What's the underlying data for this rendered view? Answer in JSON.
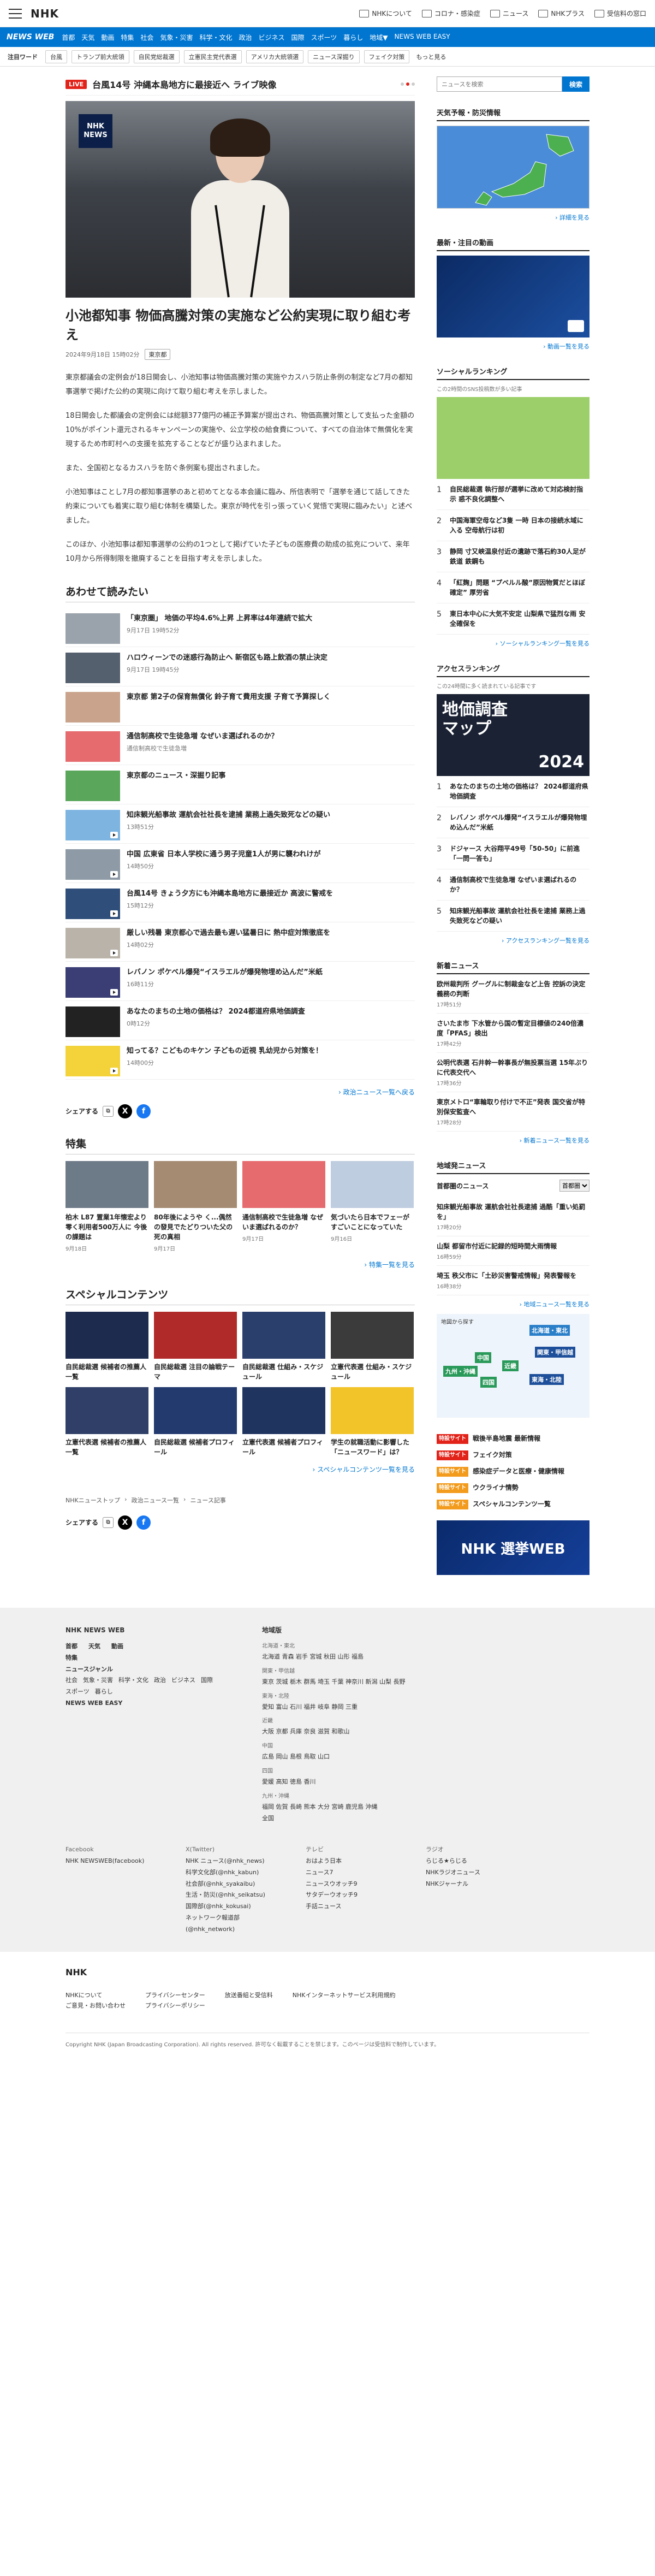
{
  "header": {
    "logo": "NHK",
    "links": [
      "NHKについて",
      "コロナ・感染症",
      "ニュース",
      "NHKプラス",
      "受信料の窓口"
    ]
  },
  "nav": {
    "brand": "NEWS WEB",
    "items": [
      "首都",
      "天気",
      "動画",
      "特集",
      "社会",
      "気象・災害",
      "科学・文化",
      "政治",
      "ビジネス",
      "国際",
      "スポーツ",
      "暮らし",
      "地域▼",
      "NEWS WEB EASY"
    ]
  },
  "keywords": {
    "label": "注目ワード",
    "items": [
      "台風",
      "トランプ前大統領",
      "自民党総裁選",
      "立憲民主党代表選",
      "アメリカ大統領選",
      "ニュース深掘り",
      "フェイク対策"
    ],
    "more": "もっと見る"
  },
  "live": {
    "badge": "LIVE",
    "text": "台風14号 沖縄本島地方に最接近へ ライブ映像"
  },
  "hero": {
    "logo1": "NHK",
    "logo2": "NEWS"
  },
  "article": {
    "title": "小池都知事 物価高騰対策の実施など公約実現に取り組む考え",
    "date": "2024年9月18日 15時02分",
    "tag": "東京都",
    "paragraphs": [
      "東京都議会の定例会が18日開会し、小池知事は物価高騰対策の実施やカスハラ防止条例の制定など7月の都知事選挙で掲げた公約の実現に向けて取り組む考えを示しました。",
      "18日開会した都議会の定例会には総額377億円の補正予算案が提出され、物価高騰対策として支払った金額の10%がポイント還元されるキャンペーンの実施や、公立学校の給食費について、すべての自治体で無償化を実現するため市町村への支援を拡充することなどが盛り込まれました。",
      "また、全国初となるカスハラを防ぐ条例案も提出されました。",
      "小池知事はことし7月の都知事選挙のあと初めてとなる本会議に臨み、所信表明で「選挙を通じて話してきた約束についても着実に取り組む体制を構築した。東京が時代を引っ張っていく覚悟で実現に臨みたい」と述べました。",
      "このほか、小池知事は都知事選挙の公約の1つとして掲げていた子どもの医療費の助成の拡充について、来年10月から所得制限を撤廃することを目指す考えを示しました。"
    ]
  },
  "related": {
    "heading": "あわせて読みたい",
    "items": [
      {
        "title": "「東京圏」 地価の平均4.6%上昇 上昇率は4年連続で拡大",
        "date": "9月17日 19時52分"
      },
      {
        "title": "ハロウィーンでの迷惑行為防止へ 新宿区も路上飲酒の禁止決定",
        "date": "9月17日 19時45分"
      },
      {
        "title": "東京都 第2子の保育無償化 鈴子育て費用支援 子育て予算探しく",
        "date": ""
      },
      {
        "title": "通信制高校で生徒急増 なぜいま選ばれるのか？",
        "date": "通信制高校で生徒急増"
      },
      {
        "title": "東京都のニュース・深掘り記事",
        "date": ""
      },
      {
        "title": "知床観光船事故 運航会社社長を逮捕 業務上過失致死などの疑い",
        "date": "13時51分"
      },
      {
        "title": "中国 広東省 日本人学校に通う男子児童1人が男に襲われけが",
        "date": "14時50分"
      },
      {
        "title": "台風14号 きょう夕方にも沖縄本島地方に最接近か 高波に警戒を",
        "date": "15時12分"
      },
      {
        "title": "厳しい残暑 東京都心で過去最も遅い猛暑日に 熱中症対策徹底を",
        "date": "14時02分"
      },
      {
        "title": "レバノン ポケベル爆発“イスラエルが爆発物埋め込んだ”米紙",
        "date": "16時11分"
      },
      {
        "title": "あなたのまちの土地の価格は？ 2024都道府県地価調査",
        "date": "0時12分"
      },
      {
        "title": "知ってる？こどものキケン 子どもの近視 乳幼児から対策を！",
        "date": "14時00分"
      }
    ],
    "more": "政治ニュース一覧へ戻る"
  },
  "share": {
    "label": "シェアする"
  },
  "features": {
    "heading": "特集",
    "items": [
      {
        "title": "柏木 L87 置業1年懐宏より零く利用者500万人に 今後の課題は",
        "date": "9月18日"
      },
      {
        "title": "80年後にようや く...偶然の發見でたどりついた父の死の真相",
        "date": "9月17日"
      },
      {
        "title": "通信制高校で生徒急増 なぜいま選ばれるのか？",
        "date": "9月17日"
      },
      {
        "title": "気づいたら日本でフェーがすごいことになっていた",
        "date": "9月16日"
      }
    ],
    "more": "特集一覧を見る"
  },
  "special": {
    "heading": "スペシャルコンテンツ",
    "items": [
      "自民総裁選 候補者の推薦人一覧",
      "自民総裁選 注目の論戦テーマ",
      "自民総裁選 仕組み・スケジュール",
      "立憲代表選 仕組み・スケジュール",
      "立憲代表選 候補者の推薦人一覧",
      "自民総裁選 候補者プロフィール",
      "立憲代表選 候補者プロフィール",
      "学生の就職活動に影響した「ニュースワード」は？"
    ],
    "more": "スペシャルコンテンツ一覧を見る"
  },
  "breadcrumb": [
    "NHKニューストップ",
    "政治ニュース一覧",
    "ニュース記事"
  ],
  "sidebar": {
    "search_placeholder": "ニュースを検索",
    "search_button": "検索",
    "weather": {
      "heading": "天気予報・防災情報",
      "link": "詳細を見る"
    },
    "video": {
      "heading": "最新・注目の動画",
      "link": "動画一覧を見る"
    },
    "social": {
      "heading": "ソーシャルランキング",
      "sub": "この2時間のSNS投稿数が多い記事",
      "items": [
        "自民総裁選 執行部が選挙に改めて対応検討指示 惑不良化調整へ",
        "中国海軍空母など3隻 一時 日本の接続水域に入る 空母航行は初",
        "静岡 寸又峡温泉付近の遺跡で落石約30人足が鉄道 鉄鋼も",
        "「紅麹」問題 “プベルル酸”原因物質だとほぼ確定” 厚労省",
        "東日本中心に大気不安定 山梨県で猛烈な雨 安全確保を"
      ],
      "link": "ソーシャルランキング一覧を見る"
    },
    "access": {
      "heading": "アクセスランキング",
      "sub": "この24時間に多く読まれている記事です",
      "banner1": "地価調査",
      "banner2": "マップ",
      "banner3": "2024",
      "items": [
        "あなたのまちの土地の価格は？ 2024都道府県地価調査",
        "レバノン ポケベル爆発“イスラエルが爆発物埋め込んだ”米紙",
        "ドジャース 大谷翔平49号「50-50」に前進 「一問一答も」",
        "通信制高校で生徒急増 なぜいま選ばれるのか？",
        "知床観光船事故 運航会社社長を逮捕 業務上過失致死などの疑い"
      ],
      "link": "アクセスランキング一覧を見る"
    },
    "newnews": {
      "heading": "新着ニュース",
      "items": [
        {
          "title": "欧州裁判所 グーグルに制裁金など上告 控訴の決定義務の判断",
          "date": "17時51分"
        },
        {
          "title": "さいたま市 下水管から国の暫定目標値の240倍濃度「PFAS」検出",
          "date": "17時42分"
        },
        {
          "title": "公明代表選 石井幹一幹事長が無投票当選 15年ぶりに代表交代へ",
          "date": "17時36分"
        },
        {
          "title": "東京メトロ“車輪取り付けで不正”発表 国交省が特別保安監査へ",
          "date": "17時28分"
        }
      ],
      "link": "新着ニュース一覧を見る"
    },
    "regional": {
      "heading": "地域発ニュース",
      "select_label": "首都圏のニュース",
      "select_value": "首都圏",
      "items": [
        {
          "title": "知床観光船事故 運航会社社長逮捕 過酷「重い処罰を」",
          "date": "17時20分"
        },
        {
          "title": "山梨 都留市付近に記録的短時間大雨情報",
          "date": "16時59分"
        },
        {
          "title": "埼玉 秩父市に「土砂災害警戒情報」発表警報を",
          "date": "16時38分"
        }
      ],
      "link": "地域ニュース一覧を見る",
      "map_note": "地図から探す",
      "areas": [
        "北海道・東北",
        "関東・甲信越",
        "東海・北陸",
        "近畿",
        "中国",
        "四国",
        "九州・沖縄"
      ]
    },
    "banners": [
      {
        "badge": "特設サイト",
        "text": "戦後半島地震 最新情報"
      },
      {
        "badge": "特設サイト",
        "text": "フェイク対策"
      },
      {
        "badge": "特設サイト",
        "text": "感染症データと医療・健康情報"
      },
      {
        "badge": "特設サイト",
        "text": "ウクライナ情勢"
      },
      {
        "badge": "特設サイト",
        "text": "スペシャルコンテンツ一覧"
      }
    ],
    "senkyo": "NHK 選挙WEB"
  },
  "footer": {
    "brand": "NHK NEWS WEB",
    "cat1": [
      "首都",
      "天気",
      "動画"
    ],
    "cat2": [
      "特集"
    ],
    "genre_label": "ニュースジャンル",
    "genres": [
      "社会",
      "気象・災害",
      "科学・文化",
      "政治",
      "ビジネス",
      "国際",
      "スポーツ",
      "暮らし"
    ],
    "easy": "NEWS WEB EASY",
    "region_head": "地域版",
    "regions": [
      {
        "g": "北海道・東北",
        "p": "北海道 青森 岩手 宮城 秋田 山形 福島"
      },
      {
        "g": "関東・甲信越",
        "p": "東京 茨城 栃木 群馬 埼玉 千葉 神奈川 新潟 山梨 長野"
      },
      {
        "g": "東海・北陸",
        "p": "愛知 富山 石川 福井 岐阜 静岡 三重"
      },
      {
        "g": "近畿",
        "p": "大阪 京都 兵庫 奈良 滋賀 和歌山"
      },
      {
        "g": "中国",
        "p": "広島 岡山 島根 鳥取 山口"
      },
      {
        "g": "四国",
        "p": "愛媛 高知 徳島 香川"
      },
      {
        "g": "九州・沖縄",
        "p": "福岡 佐賀 長崎 熊本 大分 宮崎 鹿児島 沖縄"
      }
    ],
    "all": "全国",
    "social_heads": [
      "Facebook",
      "X(Twitter)",
      "テレビ",
      "ラジオ"
    ],
    "fb": [
      "NHK NEWSWEB(facebook)"
    ],
    "tw": [
      "NHK ニュース(@nhk_news)",
      "科学文化部(@nhk_kabun)",
      "社会部(@nhk_syakaibu)",
      "生活・防災(@nhk_seikatsu)",
      "国際部(@nhk_kokusai)",
      "ネットワーク報道部(@nhk_network)"
    ],
    "tv": [
      "おはよう日本",
      "ニュース7",
      "ニュースウオッチ9",
      "サタデーウオッチ9",
      "手話ニュース"
    ],
    "radio": [
      "らじる★らじる",
      "NHKラジオニュース",
      "NHKジャーナル"
    ],
    "bottom_logo": "NHK",
    "bottom_links": [
      "NHKについて",
      "プライバシーセンター",
      "放送番組と受信料",
      "NHKインターネットサービス利用規約",
      "ご意見・お問い合わせ",
      "プライバシーポリシー"
    ],
    "copyright": "Copyright NHK (Japan Broadcasting Corporation). All rights reserved. 許可なく転載することを禁じます。このページは受信料で制作しています。"
  },
  "colors": {
    "primary": "#0076d1",
    "live": "#e2231a",
    "senkyo": "#0a2a6b"
  }
}
